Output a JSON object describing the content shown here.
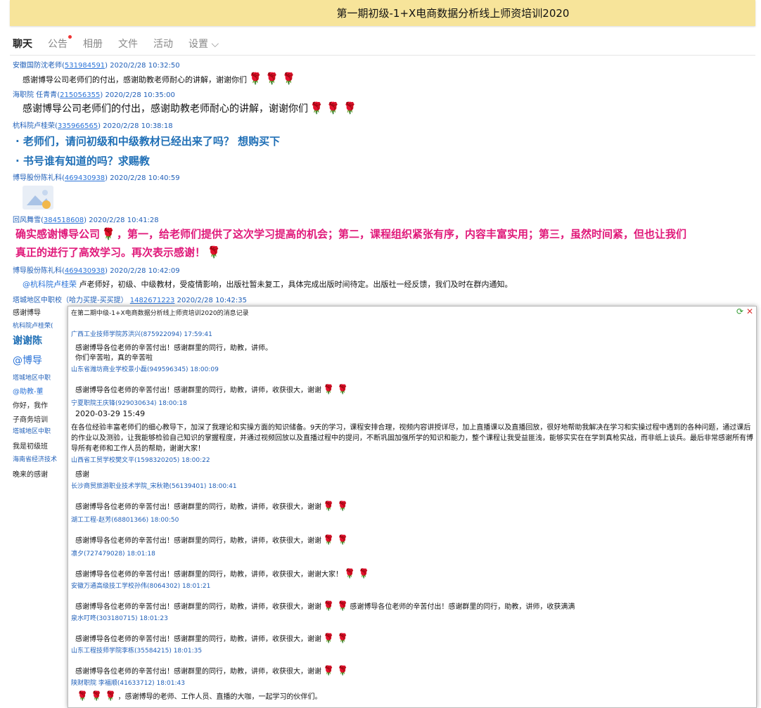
{
  "window": {
    "title": "第一期初级-1+X电商数据分析线上师资培训2020"
  },
  "tabs": [
    {
      "label": "聊天",
      "active": true
    },
    {
      "label": "公告",
      "badge": true
    },
    {
      "label": "相册"
    },
    {
      "label": "文件"
    },
    {
      "label": "活动"
    },
    {
      "label": "设置 ⌵"
    }
  ],
  "chat": [
    {
      "sender": "安徽国防沈老师",
      "id": "531984591",
      "time": "2020/2/28 10:32:50",
      "text": "感谢博导公司老师们的付出，感谢助教老师耐心的讲解，谢谢你们"
    },
    {
      "sender": "海职院 任青青",
      "id": "215056355",
      "time": "2020/2/28 10:35:00",
      "text": "感谢博导公司老师们的付出，感谢助教老师耐心的讲解，谢谢你们"
    },
    {
      "sender": "杭科院卢桂荣",
      "id": "335966565",
      "time": "2020/2/28 10:38:18",
      "text": "老师们，请问初级和中级教材已经出来了吗？ 想购买下",
      "text2": "书号谁有知道的吗？求赐教"
    },
    {
      "sender": "博导股份陈礼科",
      "id": "469430938",
      "time": "2020/2/28 10:40:59"
    },
    {
      "sender": "回风舞雪",
      "id": "384518608",
      "time": "2020/2/28 10:41:28",
      "text": "确实感谢博导公司",
      "text_b": "，第一，给老师们提供了这次学习提高的机会；第二，课程组织紧张有序，内容丰富实用；第三，虽然时间紧，但也让我们",
      "text2": "真正的进行了高效学习。再次表示感谢！"
    },
    {
      "sender": "博导股份陈礼科",
      "id": "469430938",
      "time": "2020/2/28 10:42:09",
      "mention": "@杭科院卢桂荣",
      "text": " 卢老师好，初级、中级教材，受疫情影响，出版社暂未复工，具体完成出版时间待定。出版社一经反馈，我们及时在群内通知。"
    },
    {
      "sender": "塔城地区中职校（哈力买提-买买提）",
      "id": "1482671223",
      "time": "2020/2/28 10:42:35"
    }
  ],
  "partial_left": [
    "感谢博导",
    "杭科院卢桂荣(",
    "谢谢陈",
    "@博导",
    "塔城地区中职",
    "@助教-董",
    "你好，我作",
    "子商务培训",
    "塔城地区中职",
    "我是初级班",
    "海南省经济技术",
    "晚来的感谢"
  ],
  "overlay": {
    "title": "在第二期中级-1+X电商数据分析线上师资培训2020的消息记录",
    "items": [
      {
        "h": "广西工业技师学院苏洪兴(875922094) 17:59:41",
        "lines": [
          "感谢博导各位老师的辛苦付出！感谢群里的同行，助教，讲师。",
          "你们辛苦啦，真的辛苦啦"
        ]
      },
      {
        "h": "山东省潍坊商业学校景小磊(949596345) 18:00:09",
        "lines": [
          "感谢博导各位老师的辛苦付出！感谢群里的同行，助教，讲师，收获很大，谢谢"
        ]
      },
      {
        "h": "宁夏职院王庆锋(929030634) 18:00:18",
        "lines": [
          "2020-03-29 15:49",
          "在各位经验丰富老师们的细心教导下，加深了我理论和实操方面的知识储备。9天的学习，课程安排合理，视频内容讲授详尽，加上直播课以及直播回放，很好地帮助我解决在学习和实操过程中遇到的各种问题，通过课后",
          "的作业以及测验，让我能够检验自己知识的掌握程度，并通过视频回放以及直播过程中的提问，不断巩固加强所学的知识和能力，整个课程让我受益匪浅，能够实实在在学到真枪实战，而非纸上谈兵。最后非常感谢所有博",
          "导所有老师和工作人员的帮助，谢谢大家！"
        ]
      },
      {
        "h": "山西省工贸学校樊文平(1598320205) 18:00:22",
        "lines": [
          "感谢"
        ]
      },
      {
        "h": "长沙商贸旅游职业技术学院_宋秋艳(56139401) 18:00:41",
        "lines": [
          "感谢博导各位老师的辛苦付出！感谢群里的同行，助教，讲师，收获很大，谢谢"
        ]
      },
      {
        "h": "湖工工程-赵芳(68801366) 18:00:50",
        "lines": [
          "感谢博导各位老师的辛苦付出！感谢群里的同行，助教，讲师，收获很大，谢谢"
        ]
      },
      {
        "h": "凛夕(727479028) 18:01:18",
        "lines": [
          "感谢博导各位老师的辛苦付出！感谢群里的同行，助教，讲师，收获很大，谢谢大家！"
        ]
      },
      {
        "h": "安徽万通高级技工学校孙伟(8064302) 18:01:21",
        "lines": [
          "感谢博导各位老师的辛苦付出！感谢群里的同行，助教，讲师，收获很大，谢谢"
        ],
        "tail": "感谢博导各位老师的辛苦付出！感谢群里的同行，助教，讲师，收获满满"
      },
      {
        "h": "泉水叮咚(303180715) 18:01:23",
        "lines": [
          "感谢博导各位老师的辛苦付出！感谢群里的同行，助教，讲师，收获很大，谢谢"
        ]
      },
      {
        "h": "山东工程技师学院李栋(35584215) 18:01:35",
        "lines": [
          "感谢博导各位老师的辛苦付出！感谢群里的同行，助教，讲师，收获很大，谢谢"
        ]
      },
      {
        "h": "陕财职院 李福顺(41633712) 18:01:43",
        "lines": [
          "，感谢博导的老师、工作人员、直播的大咖，一起学习的伙伴们。"
        ]
      }
    ]
  },
  "icons": {
    "rose": "rose-icon",
    "refresh": "refresh-icon",
    "close": "close-icon",
    "image": "image-placeholder-icon"
  }
}
